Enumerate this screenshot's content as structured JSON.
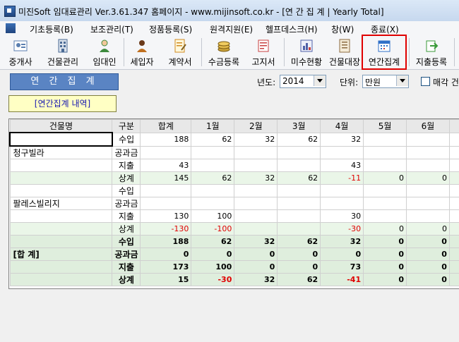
{
  "window": {
    "title": "미진Soft 임대료관리 Ver.3.61.347          홈페이지 - www.mijinsoft.co.kr - [연 간 집 계  |  Yearly Total]"
  },
  "menu": [
    {
      "label": "기초등록(B)"
    },
    {
      "label": "보조관리(T)"
    },
    {
      "label": "정품등록(S)"
    },
    {
      "label": "원격지원(E)"
    },
    {
      "label": "헬프데스크(H)"
    },
    {
      "label": "창(W)"
    },
    {
      "label": "종료(X)"
    }
  ],
  "toolbar": [
    {
      "label": "중개사",
      "icon": "broker-icon",
      "color": "#5b7fb0"
    },
    {
      "label": "건물관리",
      "icon": "building-icon",
      "color": "#4a6a95"
    },
    {
      "label": "임대인",
      "icon": "landlord-icon",
      "color": "#3d8a3d"
    },
    {
      "label": "세입자",
      "icon": "tenant-icon",
      "color": "#c07020"
    },
    {
      "label": "계약서",
      "icon": "contract-icon",
      "color": "#d08a20"
    },
    {
      "label": "수금등록",
      "icon": "coins-icon",
      "color": "#c9a23a"
    },
    {
      "label": "고지서",
      "icon": "notice-icon",
      "color": "#c84040"
    },
    {
      "label": "미수현황",
      "icon": "unpaid-icon",
      "color": "#5060a8"
    },
    {
      "label": "건물대장",
      "icon": "ledger-icon",
      "color": "#8a6a40"
    },
    {
      "label": "연간집계",
      "icon": "calendar-icon",
      "color": "#3070c8"
    },
    {
      "label": "지출등록",
      "icon": "expense-icon",
      "color": "#3a9a3a"
    }
  ],
  "panel": {
    "section_title": "연 간 집 계",
    "year_label": "년도:",
    "year_value": "2014",
    "unit_label": "단위:",
    "unit_value": "만원",
    "closing_label": "매각 건",
    "subtab_label": "[연간집계 내역]"
  },
  "table": {
    "headers": [
      "건물명",
      "구분",
      "합계",
      "1월",
      "2월",
      "3월",
      "4월",
      "5월",
      "6월"
    ],
    "buildings": [
      {
        "name": "청구빌라",
        "rows": [
          {
            "cat": "수입",
            "vals": [
              "188",
              "62",
              "32",
              "62",
              "32",
              "",
              ""
            ]
          },
          {
            "cat": "공과금",
            "vals": [
              "",
              "",
              "",
              "",
              "",
              "",
              ""
            ]
          },
          {
            "cat": "지출",
            "vals": [
              "43",
              "",
              "",
              "",
              "43",
              "",
              ""
            ]
          },
          {
            "cat": "상계",
            "vals": [
              "145",
              "62",
              "32",
              "62",
              "-11",
              "0",
              "0"
            ]
          }
        ]
      },
      {
        "name": "팔레스빌리지",
        "rows": [
          {
            "cat": "수입",
            "vals": [
              "",
              "",
              "",
              "",
              "",
              "",
              ""
            ]
          },
          {
            "cat": "공과금",
            "vals": [
              "",
              "",
              "",
              "",
              "",
              "",
              ""
            ]
          },
          {
            "cat": "지출",
            "vals": [
              "130",
              "100",
              "",
              "",
              "30",
              "",
              ""
            ]
          },
          {
            "cat": "상계",
            "vals": [
              "-130",
              "-100",
              "",
              "",
              "-30",
              "0",
              "0"
            ]
          }
        ]
      }
    ],
    "total": {
      "name": "[합 계]",
      "rows": [
        {
          "cat": "수입",
          "vals": [
            "188",
            "62",
            "32",
            "62",
            "32",
            "0",
            "0"
          ]
        },
        {
          "cat": "공과금",
          "vals": [
            "0",
            "0",
            "0",
            "0",
            "0",
            "0",
            "0"
          ]
        },
        {
          "cat": "지출",
          "vals": [
            "173",
            "100",
            "0",
            "0",
            "73",
            "0",
            "0"
          ]
        },
        {
          "cat": "상계",
          "vals": [
            "15",
            "-30",
            "32",
            "62",
            "-41",
            "0",
            "0"
          ]
        }
      ]
    }
  }
}
